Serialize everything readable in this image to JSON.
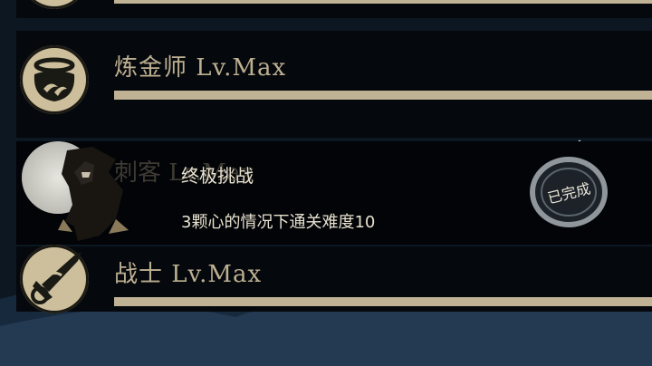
{
  "achievements": [
    {
      "icon": "cauldron-icon",
      "label": "炼金师 Lv.Max"
    },
    {
      "icon": "sword-icon",
      "label": "战士 Lv.Max"
    }
  ],
  "challenge": {
    "title": "终极挑战",
    "description": "3颗心的情况下通关难度10",
    "status": "已完成",
    "faded_label": "刺客 Lv.Max"
  },
  "colors": {
    "panel": "#05080c",
    "tan": "#cdbf9b",
    "text": "#e8e1cf"
  }
}
